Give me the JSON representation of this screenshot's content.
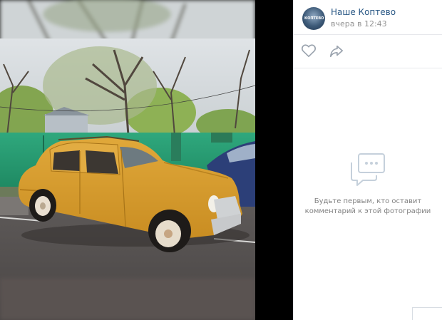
{
  "author": {
    "name": "Наше Коптево",
    "time": "вчера в 12:43",
    "avatar_text": "КОПТЕВО"
  },
  "actions": {
    "like_icon": "heart-icon",
    "share_icon": "share-arrow-icon"
  },
  "comments": {
    "empty_icon": "comment-bubble-icon",
    "empty_text": "Будьте первым, кто оставит\nкомментарий к этой фотографии"
  },
  "colors": {
    "link": "#2a5885",
    "muted": "#939393",
    "icon": "#99a2ad"
  }
}
